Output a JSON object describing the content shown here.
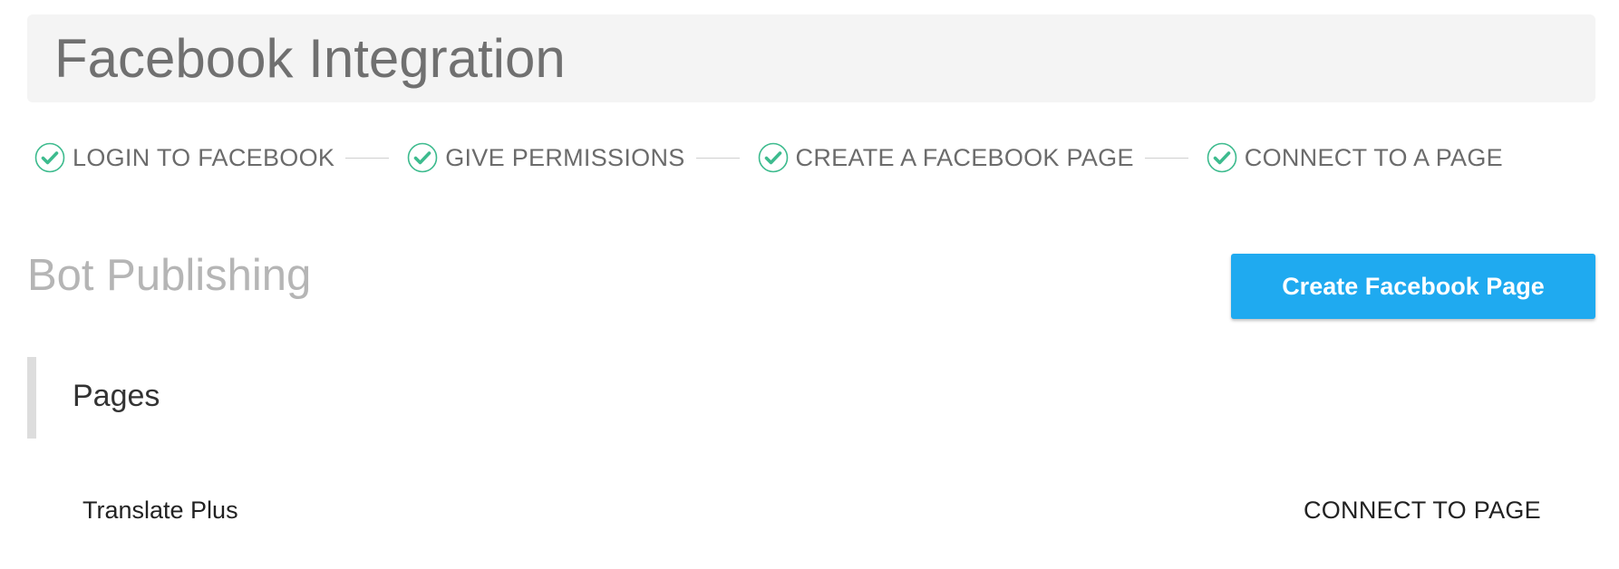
{
  "header": {
    "title": "Facebook Integration"
  },
  "steps": [
    {
      "label": "LOGIN TO FACEBOOK",
      "icon": "check-circle-icon",
      "status": "complete"
    },
    {
      "label": "GIVE PERMISSIONS",
      "icon": "check-circle-icon",
      "status": "complete"
    },
    {
      "label": "CREATE A FACEBOOK PAGE",
      "icon": "check-circle-icon",
      "status": "complete"
    },
    {
      "label": "CONNECT TO A PAGE",
      "icon": "check-circle-icon",
      "status": "complete"
    }
  ],
  "section": {
    "title": "Bot Publishing",
    "create_button_label": "Create Facebook Page"
  },
  "pages": {
    "title": "Pages",
    "items": [
      {
        "name": "Translate Plus",
        "action_label": "CONNECT TO PAGE"
      }
    ]
  },
  "colors": {
    "accent_blue": "#1faaf0",
    "check_green": "#3dbb8e",
    "header_bg": "#f4f4f4"
  }
}
